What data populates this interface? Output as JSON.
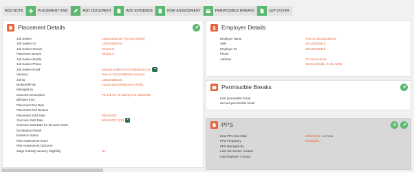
{
  "toolbar": {
    "items": [
      {
        "label": "ADD NOTE",
        "icon": "plus-icon"
      },
      {
        "label": "PLACEMENT END",
        "icon": "pencil-icon"
      },
      {
        "label": "ADD DOCUMENT",
        "icon": "document-icon"
      },
      {
        "label": "ADD EVIDENCE",
        "icon": "document-icon"
      },
      {
        "label": "RISK ASSESSMENT",
        "icon": "calendar-icon"
      },
      {
        "label": "PERMISSIBLE BREAKS",
        "icon": "calendar-icon"
      },
      {
        "label": "QJP COVER",
        "icon": "document-icon"
      }
    ]
  },
  "placement": {
    "title": "Placement Details",
    "rows": [
      {
        "k": "Job Seeker",
        "v": "220120180415, Pyrenys (MISS)"
      },
      {
        "k": "Job Seeker ID",
        "v": "220120180415"
      },
      {
        "k": "Job Seeker Stream",
        "v": "Stream B"
      },
      {
        "k": "Placement Stream",
        "v": "Stream A"
      },
      {
        "k": "Job Seeker Mobile",
        "v": ""
      },
      {
        "k": "Job Seeker Phone",
        "v": ""
      },
      {
        "k": "Job Seeker Email",
        "v": "pyrenys.prakhn+220118@gmail.com",
        "badge": "●●"
      },
      {
        "k": "Vacancy",
        "v": "Test on 220120180415 Vacancy"
      },
      {
        "k": "Job ID",
        "v": "220120180415"
      },
      {
        "k": "Brokered/FOE",
        "v": "Found own Employment (FOE)"
      },
      {
        "k": "Managed by",
        "v": ""
      },
      {
        "k": "Outcome Description",
        "v": "PS Job for FS activity test Jobseeker"
      },
      {
        "k": "Effective from",
        "v": ""
      },
      {
        "k": "Placement End Date",
        "v": ""
      },
      {
        "k": "Placement End Reason",
        "v": ""
      },
      {
        "k": "Placement Start Date",
        "v": "06/10/2017"
      },
      {
        "k": "Outcome Start Date",
        "v": "06/10/2017 (CD)",
        "badge": "●"
      },
      {
        "k": "Outcome Start Date for 26 week Claim",
        "v": ""
      },
      {
        "k": "Declaration Result",
        "v": ""
      },
      {
        "k": "Evidence Status",
        "v": ""
      },
      {
        "k": "Risk Assessment Score",
        "v": ""
      },
      {
        "k": "Risk Assessment Outcome",
        "v": ""
      },
      {
        "k": "Wage Subsidy Vacancy Eligibility",
        "v": "No"
      }
    ]
  },
  "employer": {
    "title": "Employer Details",
    "rows": [
      {
        "k": "Employer Name",
        "v": "Test on 220120180415"
      },
      {
        "k": "ABN",
        "v": "220120180415"
      },
      {
        "k": "Employer ID",
        "v": "220120180415"
      },
      {
        "k": "Phone",
        "v": ""
      },
      {
        "k": "Address",
        "v": "22 ernest street"
      },
      {
        "k": "",
        "v": "Wentworthville, 2145, NSW"
      }
    ]
  },
  "breaks": {
    "title": "Permissible Breaks",
    "rows": [
      {
        "k": "First permissible break",
        "v": ""
      },
      {
        "k": "Second permissible break",
        "v": ""
      }
    ]
  },
  "pps": {
    "title": "PPS",
    "rows": [
      {
        "k": "Next PPS Due Date",
        "v": "20/02/2018",
        "tag": "ACTION"
      },
      {
        "k": "PPS Frequency",
        "v": "Fortnightly"
      },
      {
        "k": "PPS Managed By",
        "v": ""
      },
      {
        "k": "Last Job Seeker Contact",
        "v": ""
      },
      {
        "k": "Last Employer Contact",
        "v": ""
      }
    ]
  },
  "colors": {
    "accent": "#5cb870",
    "brand": "#e8633b",
    "value": "#e8633b"
  }
}
